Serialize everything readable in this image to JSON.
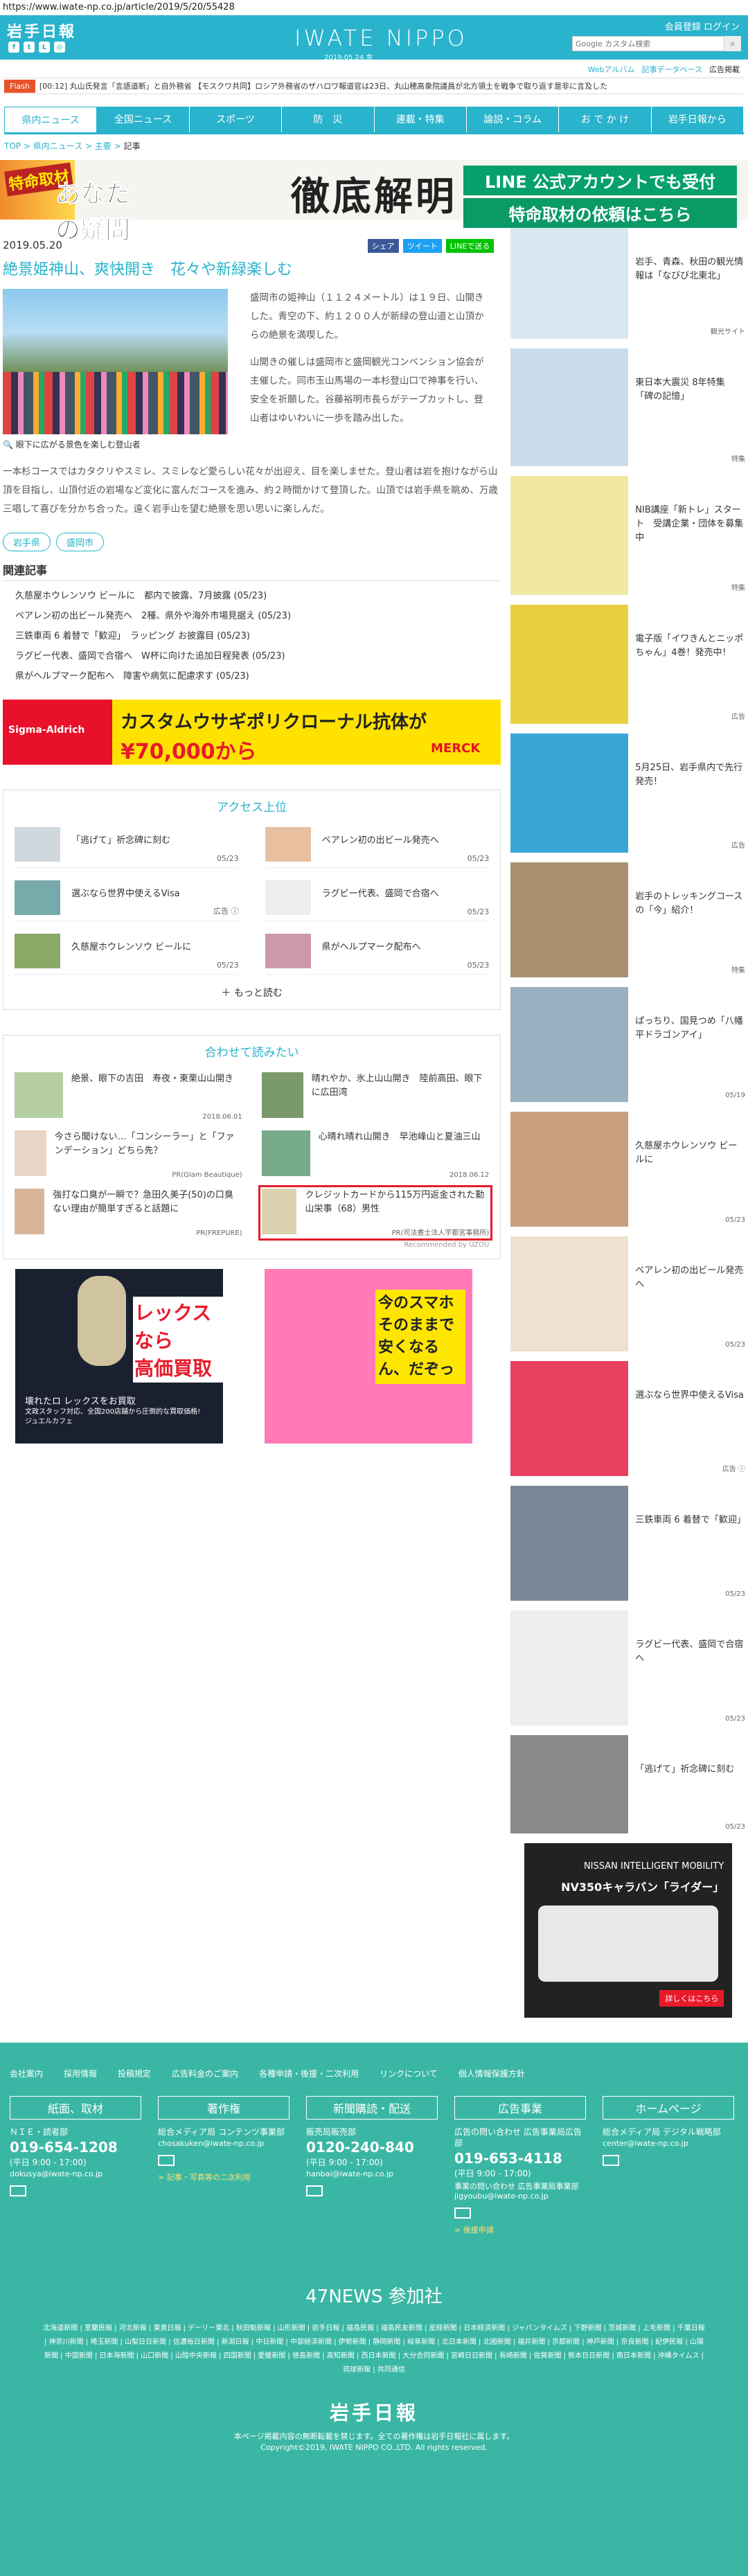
{
  "url": "https://www.iwate-np.co.jp/article/2019/5/20/55428",
  "header": {
    "logo": "岩手日報",
    "brand": "IWATE NIPPO",
    "date": "2019.05.24.金",
    "links": "会員登録  ログイン",
    "search_placeholder": "Google カスタム検索"
  },
  "subbar": {
    "a": "Webアルバム",
    "b": "記事データベース",
    "c": "広告掲載"
  },
  "flash": {
    "label": "Flash",
    "text": "[00:12] 丸山氏発言「言語道断」と自外務省  【モスクワ共同】ロシア外務省のザハロワ報道官は23日、丸山穂高衆院議員が北方領土を戦争で取り返す是非に言及した"
  },
  "nav": [
    "県内ニュース",
    "全国ニュース",
    "スポーツ",
    "防　災",
    "連載・特集",
    "論説・コラム",
    "お で か け",
    "岩手日報から"
  ],
  "crumb": {
    "top": "TOP",
    "sep": " > ",
    "a": "県内ニュース",
    "b": "主要",
    "cur": "記事"
  },
  "banner": {
    "l1": "特命取材",
    "l2": "あなたの疑問",
    "mid": "徹底解明",
    "r1": "LINE 公式アカウントでも受付",
    "r2": "特命取材の依頼はこちら"
  },
  "article": {
    "date": "2019.05.20",
    "share": [
      "シェア",
      "ツイート",
      "LINEで送る"
    ],
    "title": "絶景姫神山、爽快開き　花々や新緑楽しむ",
    "caption": "🔍 眼下に広がる景色を楽しむ登山者",
    "p1": "盛岡市の姫神山（１１２４メートル）は１９日、山開きした。青空の下、約１２００人が新緑の登山道と山頂からの絶景を満喫した。",
    "p2": "山開きの催しは盛岡市と盛岡観光コンベンション協会が主催した。同市玉山馬場の一本杉登山口で神事を行い、安全を祈願した。谷藤裕明市長らがテープカットし、登山者はゆいわいに一歩を踏み出した。",
    "p3": "一本杉コースではカタクリやスミレ、スミレなど愛らしい花々が出迎え、目を楽しませた。登山者は岩を抱けながら山頂を目指し、山頂付近の岩場など変化に富んだコースを進み、約２時間かけて登頂した。山頂では岩手県を眺め、万歳三唱して喜びを分かち合った。遠く岩手山を望む絶景を思い思いに楽しんだ。",
    "tags": [
      "岩手県",
      "盛岡市"
    ],
    "rel_h": "関連記事",
    "rel": [
      "久慈屋ホウレンソウ ビールに　都内で披露、7月披露 (05/23)",
      "ペアレン初の出ビール発売へ　2種、県外や海外市場見据え (05/23)",
      "三鉄車両 6 着替で「歓迎」　ラッピング お披露目 (05/23)",
      "ラグビー代表、盛岡で合宿へ　W杯に向けた追加日程発表 (05/23)",
      "県がヘルプマーク配布へ　障害や病気に配慮求す (05/23)"
    ]
  },
  "ad1": {
    "s": "Sigma-Aldrich",
    "h": "カスタムウサギポリクローナル抗体が",
    "p": "¥70,000から",
    "m": "MERCK"
  },
  "ranking": {
    "title": "アクセス上位",
    "more": "＋ もっと読む",
    "items": [
      {
        "t": "「逃げて」祈念碑に刻む",
        "d": "05/23"
      },
      {
        "t": "ベアレン初の出ビール発売へ",
        "d": "05/23"
      },
      {
        "t": "選ぶなら世界中使えるVisa",
        "d": "広告 ⓘ"
      },
      {
        "t": "ラグビー代表、盛岡で合宿へ",
        "d": "05/23"
      },
      {
        "t": "久慈屋ホウレンソウ ビールに",
        "d": "05/23"
      },
      {
        "t": "県がヘルプマーク配布へ",
        "d": "05/23"
      }
    ]
  },
  "recommend": {
    "title": "合わせて読みたい",
    "by": "Recommended by UZOU",
    "items": [
      {
        "t": "絶景、眼下の吉田　寿夜・東栗山山開き",
        "d": "2018.06.01"
      },
      {
        "t": "晴れやか、氷上山山開き　陸前高田、眼下に広田湾",
        "d": ""
      },
      {
        "t": "今さら聞けない…「コンシーラー」と「ファンデーション」どちら先？",
        "d": "PR(Glam Beautique)"
      },
      {
        "t": "心晴れ晴れ山開き　早池峰山と夏油三山",
        "d": "2018.06.12"
      },
      {
        "t": "強打な口臭が一瞬で？急田久美子(50)の口臭ない理由が簡単すぎると話題に",
        "d": "PR(FREPURE)"
      },
      {
        "t": "クレジットカードから115万円返金された勤山栄事（68）男性",
        "d": "PR(司法書士法人宇都宮事務所)"
      }
    ]
  },
  "ads2": {
    "r1": "レックスなら",
    "r2": "高価買取",
    "r3": "壊れたロ レックスをお買取",
    "r4": "文政スタッフ対応、全国200店舗から圧倒的な買取価格!",
    "r5": "ジュエルカフェ",
    "m1": "今のスマホそのままで安くなるん、だぞっ"
  },
  "side": [
    {
      "t": "岩手、青森、秋田の観光情報は「なびび北東北」",
      "d": "観光サイト"
    },
    {
      "t": "東日本大震災 8年特集 「碑の記憶」",
      "d": "特集"
    },
    {
      "t": "NIB講座「新トレ」スタート　受講企業・団体を募集中",
      "d": "特集"
    },
    {
      "t": "電子版「イワきんとニッポちゃん」4巻！発売中！",
      "d": "広告"
    },
    {
      "t": "5月25日、岩手県内で先行発売！",
      "d": "広告"
    },
    {
      "t": "岩手のトレッキングコースの「今」紹介！",
      "d": "特集"
    },
    {
      "t": "ぱっちり、国見つめ「八幡平ドラゴンアイ」",
      "d": "05/19"
    },
    {
      "t": "久慈屋ホウレンソウ ビールに",
      "d": "05/23"
    },
    {
      "t": "ベアレン初の出ビール発売へ",
      "d": "05/23"
    },
    {
      "t": "選ぶなら世界中使えるVisa",
      "d": "広告 ⓘ"
    },
    {
      "t": "三鉄車両 6 着替で「歓迎」",
      "d": "05/23"
    },
    {
      "t": "ラグビー代表、盛岡で合宿へ",
      "d": "05/23"
    },
    {
      "t": "「逃げて」祈念碑に刻む",
      "d": "05/23"
    }
  ],
  "nissan": {
    "n": "NISSAN INTELLIGENT MOBILITY",
    "h": "NV350キャラバン「ライダー」",
    "btn": "詳しくはこちら"
  },
  "footer": {
    "links": [
      "会社案内",
      "採用情報",
      "投稿規定",
      "広告料金のご案内",
      "各種申請・後援・二次利用",
      "リンクについて",
      "個人情報保護方針"
    ],
    "cols": [
      {
        "h": "紙面、取材",
        "l": "ＮＩＥ・読者部",
        "ph": "019-654-1208",
        "t": "(平日 9:00 - 17:00)",
        "m": "dokusya@iwate-np.co.jp",
        "lk": ""
      },
      {
        "h": "著作権",
        "l": "総合メディア局 コンテンツ事業部",
        "ph": "",
        "t": "",
        "m": "chosakuken@iwate-np.co.jp",
        "lk": "> 記事・写真等の二次利用"
      },
      {
        "h": "新聞購読・配送",
        "l": "販売局販売部",
        "ph": "0120-240-840",
        "t": "(平日 9:00 - 17:00)",
        "m": "hanbai@iwate-np.co.jp",
        "lk": ""
      },
      {
        "h": "広告事業",
        "l": "広告の問い合わせ 広告事業局広告部",
        "ph": "019-653-4118",
        "t": "(平日 9:00 - 17:00)",
        "m": "事業の問い合わせ 広告事業局事業部 jigyoubu@iwate-np.co.jp",
        "lk": "> 後援申請"
      },
      {
        "h": "ホームページ",
        "l": "総合メディア局 デジタル戦略部",
        "ph": "",
        "t": "",
        "m": "center@iwate-np.co.jp",
        "lk": ""
      }
    ],
    "news47": "47NEWS 参加社",
    "papers": "北海道新聞 | 室蘭民報 | 河北新報 | 東奥日報 | デーリー東北 | 秋田魁新報 | 山形新聞 | 岩手日報 | 福島民報 | 福島民友新聞 | 産経新聞 | 日本経済新聞 | ジャパンタイムズ | 下野新聞 | 茨城新聞 | 上毛新聞 | 千葉日報 | 神奈川新聞 | 埼玉新聞 | 山梨日日新聞 | 信濃毎日新聞 | 新潟日報 | 中日新聞 | 中部経済新聞 | 伊勢新聞 | 静岡新聞 | 岐阜新聞 | 北日本新聞 | 北國新聞 | 福井新聞 | 京都新聞 | 神戸新聞 | 奈良新聞 | 紀伊民報 | 山陽新聞 | 中国新聞 | 日本海新聞 | 山口新聞 | 山陰中央新報 | 四国新聞 | 愛媛新聞 | 徳島新聞 | 高知新聞 | 西日本新聞 | 大分合同新聞 | 宮崎日日新聞 | 長崎新聞 | 佐賀新聞 | 熊本日日新聞 | 南日本新聞 | 沖縄タイムス | 琉球新報 | 共同通信",
    "logo": "岩手日報",
    "copy1": "本ページ掲載内容の無断転載を禁じます。全ての著作権は岩手日報社に属します。",
    "copy2": "Copyright©2019, IWATE NIPPO CO.,LTD. All rights reserved."
  }
}
